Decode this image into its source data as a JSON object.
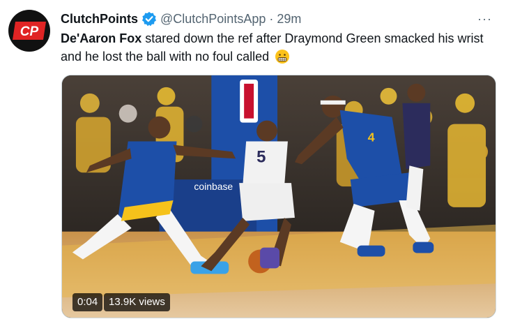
{
  "author": {
    "display_name": "ClutchPoints",
    "handle": "@ClutchPointsApp",
    "separator": "·",
    "time": "29m",
    "avatar_text": "CP",
    "verified": true
  },
  "tweet": {
    "name_bold": "De'Aaron Fox",
    "text_rest": " stared down the ref after Draymond Green smacked his wrist and he lost the ball with no foul called",
    "emoji": "grimacing-face-icon"
  },
  "media": {
    "duration": "0:04",
    "views": "13.9K views",
    "jersey_home": "5",
    "jersey_away": "4",
    "court_ad": "coinbase"
  },
  "colors": {
    "brand_red": "#e02424",
    "verified_blue": "#1d9bf0",
    "warriors_blue": "#1d4fa8",
    "warriors_gold": "#f5c21b",
    "court": "#d9a65a"
  },
  "more_label": "···"
}
